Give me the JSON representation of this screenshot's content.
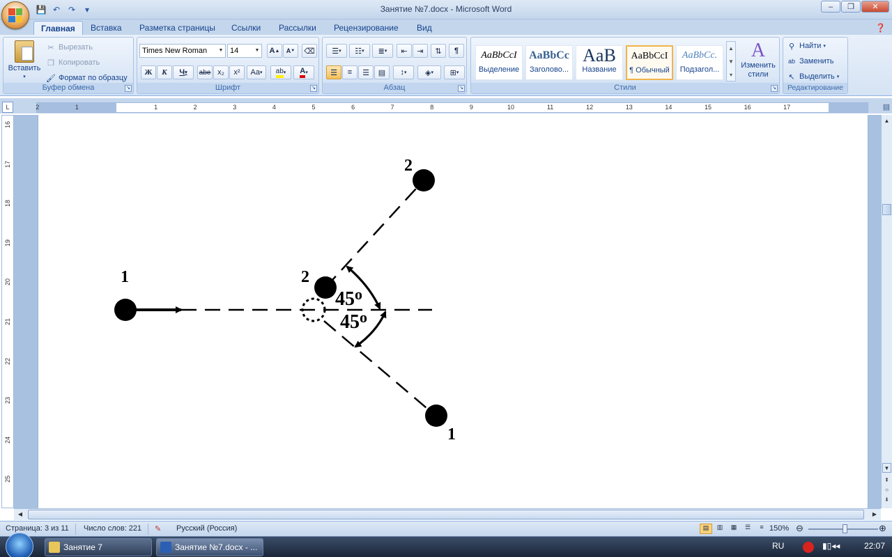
{
  "window": {
    "title": "Занятие №7.docx - Microsoft Word"
  },
  "qat": {
    "save": "💾",
    "undo": "↶",
    "redo": "↷",
    "more": "▾"
  },
  "tabs": [
    "Главная",
    "Вставка",
    "Разметка страницы",
    "Ссылки",
    "Рассылки",
    "Рецензирование",
    "Вид"
  ],
  "clipboard": {
    "paste": "Вставить",
    "cut": "Вырезать",
    "copy": "Копировать",
    "format_painter": "Формат по образцу",
    "label": "Буфер обмена"
  },
  "font": {
    "family": "Times New Roman",
    "size": "14",
    "label": "Шрифт",
    "bold": "Ж",
    "italic": "К",
    "underline": "Ч",
    "strike": "abe",
    "sub": "x₂",
    "sup": "x²",
    "case": "Aa",
    "grow": "A",
    "shrink": "A"
  },
  "paragraph": {
    "label": "Абзац"
  },
  "styles": {
    "label": "Стили",
    "items": [
      {
        "sample": "AaBbCcI",
        "name": "Выделение"
      },
      {
        "sample": "AaBbCc",
        "name": "Заголово..."
      },
      {
        "sample": "AaB",
        "name": "Название"
      },
      {
        "sample": "AaBbCcI",
        "name": "¶ Обычный"
      },
      {
        "sample": "AaBbCc.",
        "name": "Подзагол..."
      }
    ],
    "change": "Изменить стили"
  },
  "editing": {
    "find": "Найти",
    "replace": "Заменить",
    "select": "Выделить",
    "label": "Редактирование"
  },
  "ruler": {
    "h_numbers": [
      "2",
      "1",
      "1",
      "2",
      "3",
      "4",
      "5",
      "6",
      "7",
      "8",
      "9",
      "10",
      "11",
      "12",
      "13",
      "14",
      "15",
      "16",
      "17"
    ],
    "v_numbers": [
      "16",
      "17",
      "18",
      "19",
      "20",
      "21",
      "22",
      "23",
      "24",
      "25"
    ]
  },
  "figure": {
    "labels": [
      "1",
      "2",
      "2",
      "1"
    ],
    "angle_top": "45",
    "angle_bottom": "45",
    "degree": "o"
  },
  "status": {
    "page": "Страница: 3 из 11",
    "words": "Число слов: 221",
    "language": "Русский (Россия)",
    "zoom": "150%"
  },
  "taskbar": {
    "items": [
      "Занятие 7",
      "Занятие №7.docx - ..."
    ],
    "lang": "RU",
    "time": "22:07"
  }
}
